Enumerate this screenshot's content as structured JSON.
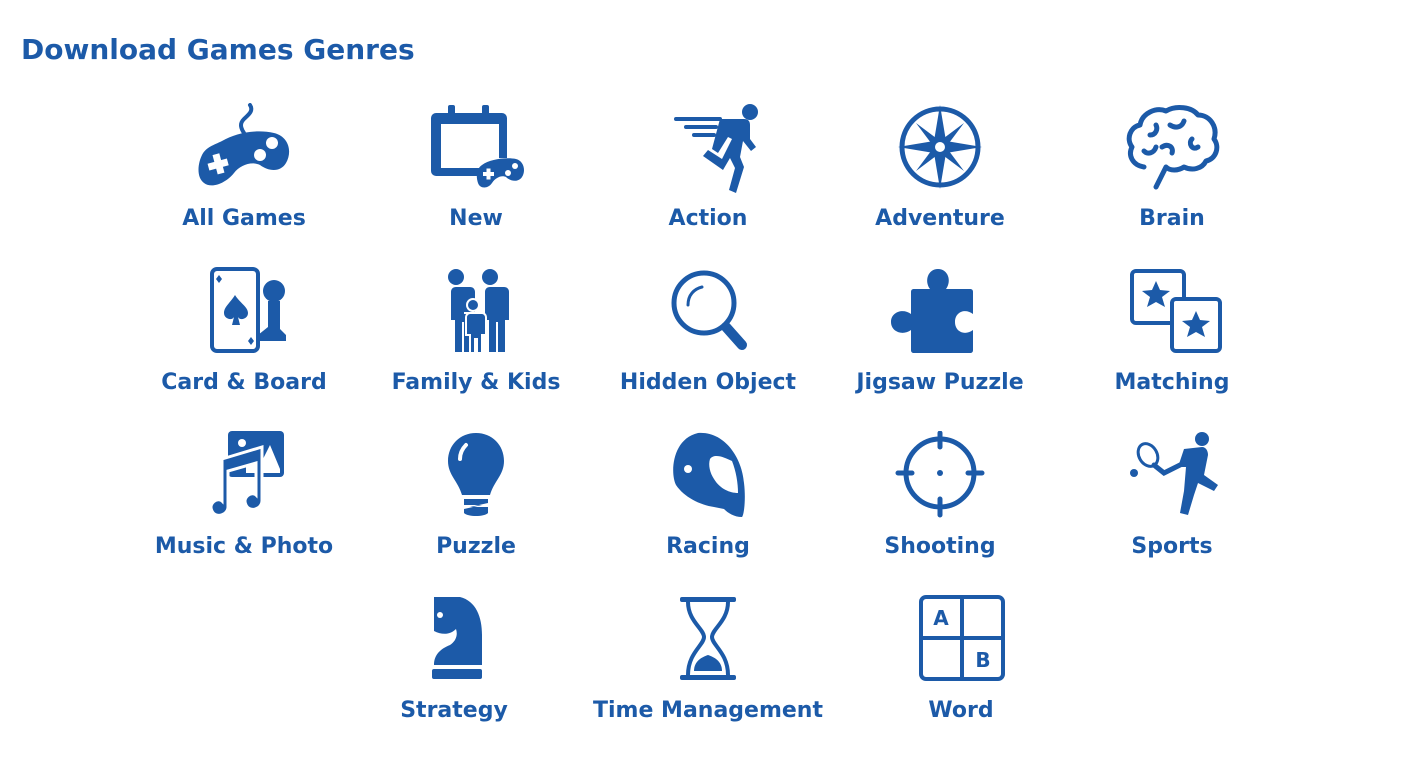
{
  "page": {
    "title": "Download Games Genres",
    "accent_color": "#1c5aa8"
  },
  "genres": [
    {
      "label": "All Games",
      "icon": "gamepad-icon"
    },
    {
      "label": "New",
      "icon": "calendar-gamepad-icon"
    },
    {
      "label": "Action",
      "icon": "running-man-icon"
    },
    {
      "label": "Adventure",
      "icon": "compass-icon"
    },
    {
      "label": "Brain",
      "icon": "brain-icon"
    },
    {
      "label": "Card & Board",
      "icon": "card-pawn-icon"
    },
    {
      "label": "Family & Kids",
      "icon": "family-icon"
    },
    {
      "label": "Hidden Object",
      "icon": "magnifier-icon"
    },
    {
      "label": "Jigsaw Puzzle",
      "icon": "puzzle-piece-icon"
    },
    {
      "label": "Matching",
      "icon": "matching-cards-icon"
    },
    {
      "label": "Music & Photo",
      "icon": "music-photo-icon"
    },
    {
      "label": "Puzzle",
      "icon": "lightbulb-icon"
    },
    {
      "label": "Racing",
      "icon": "helmet-icon"
    },
    {
      "label": "Shooting",
      "icon": "crosshair-icon"
    },
    {
      "label": "Sports",
      "icon": "tennis-player-icon"
    },
    {
      "label": "Strategy",
      "icon": "chess-knight-icon"
    },
    {
      "label": "Time Management",
      "icon": "hourglass-icon"
    },
    {
      "label": "Word",
      "icon": "letter-grid-icon"
    }
  ]
}
